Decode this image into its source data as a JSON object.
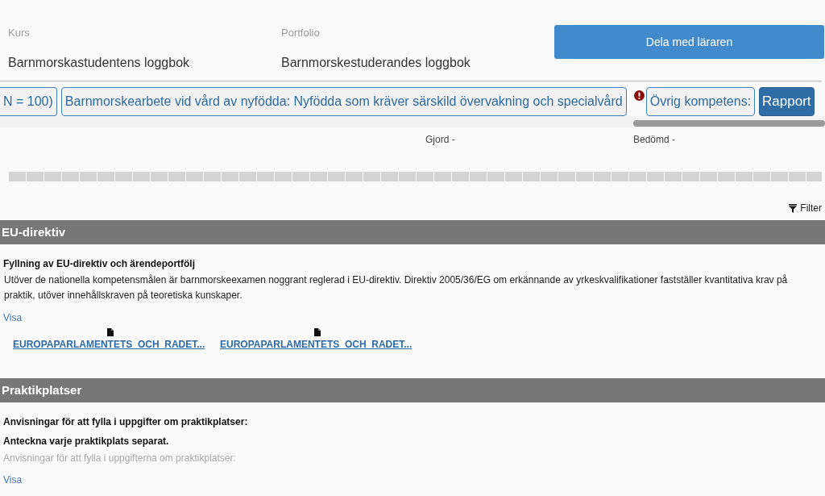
{
  "header": {
    "fields": [
      {
        "label": "Kurs",
        "value": "Barnmorskastudentens loggbok"
      },
      {
        "label": "Portfolio",
        "value": "Barnmorskestuderandes loggbok"
      }
    ],
    "share_button": "Dela med läraren"
  },
  "tabs": [
    {
      "label": "N = 100)",
      "selected": false,
      "warning": false
    },
    {
      "label": "Barnmorskearbete vid vård av nyfödda: Nyfödda som kräver särskild övervakning och specialvård",
      "selected": false,
      "warning": false
    },
    {
      "label": "Övrig kompetens:",
      "selected": false,
      "warning": true
    },
    {
      "label": "Rapport",
      "selected": true,
      "warning": false
    }
  ],
  "status": {
    "done": "Gjord -",
    "assessed": "Bedömd -"
  },
  "progress": {
    "level": 0
  },
  "filter": "Filter",
  "sections": [
    {
      "title": "EU-direktiv",
      "blocks": [
        {
          "kind": "heading",
          "text": "Fyllning av EU-direktiv och ärendeportfölj"
        },
        {
          "kind": "paragraph",
          "text": "Utöver de nationella kompetensmålen är barnmorskeexamen noggrant reglerad i EU-direktiv. Direktiv 2005/36/EG om erkännande av yrkeskvalifikationer fastställer kvantitativa krav på praktik, utöver innehållskraven på teoretiska kunskaper."
        },
        {
          "kind": "link",
          "text": "Visa"
        },
        {
          "kind": "files",
          "items": [
            "EUROPAPARLAMENTETS_OCH_RADET...",
            "EUROPAPARLAMENTETS_OCH_RADET..."
          ]
        }
      ]
    },
    {
      "title": "Praktikplatser",
      "blocks": [
        {
          "kind": "heading",
          "text": "Anvisningar för att fylla i uppgifter om praktikplatser:"
        },
        {
          "kind": "note",
          "text": "Anteckna varje praktikplats separat."
        },
        {
          "kind": "faded",
          "text": "Anvisningar för att fylla i uppgifterna om praktikplatser:"
        },
        {
          "kind": "link",
          "text": "Visa"
        }
      ]
    }
  ]
}
